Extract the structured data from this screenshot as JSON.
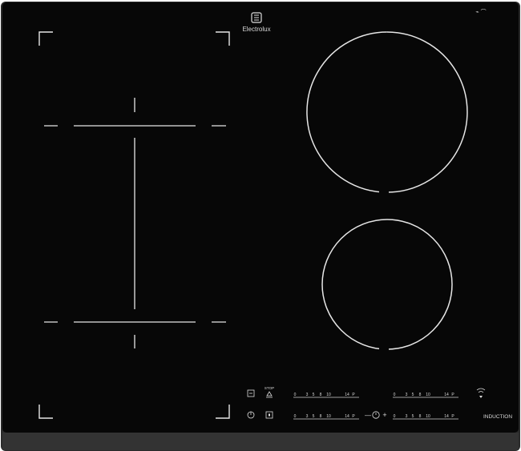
{
  "brand": {
    "name": "Electrolux"
  },
  "top_right_marks": "⌁ ⌒",
  "controls": {
    "stop_label": "STOP",
    "induction_label": "INDUCTION",
    "slider_scale": [
      "0",
      "3",
      "5",
      "8",
      "10",
      "14",
      "P"
    ],
    "timer_minus": "—",
    "timer_plus": "+"
  },
  "icons": {
    "brand": "electrolux-logo-icon",
    "bridge": "bridge-zone-icon",
    "stop": "stop-go-icon",
    "power": "power-icon",
    "lock": "lock-icon",
    "timer": "timer-icon",
    "hob2hood": "wireless-hood-icon"
  },
  "colors": {
    "glass": "#070707",
    "frame": "#2a2a2a",
    "lines": "#e6e6e6",
    "text": "#d8d8d8"
  }
}
